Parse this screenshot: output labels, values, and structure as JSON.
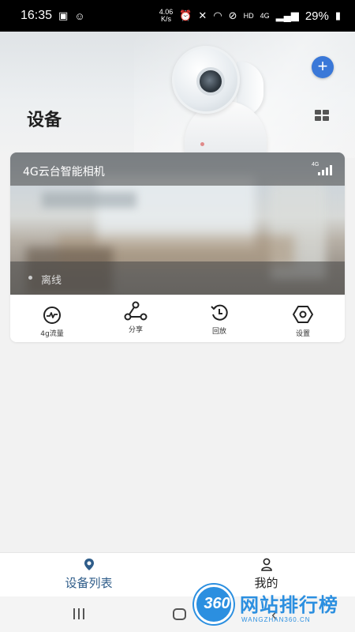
{
  "status_bar": {
    "time": "16:35",
    "speed_value": "4.06",
    "speed_unit": "K/s",
    "network": "4G",
    "hd": "HD",
    "battery": "29%"
  },
  "header": {
    "title": "设备",
    "add_icon": "plus-icon",
    "layout_icon": "grid-icon"
  },
  "device_card": {
    "name": "4G云台智能相机",
    "signal_label": "4G",
    "signal_level": 0.75,
    "status": "离线",
    "actions": [
      {
        "label": "4g流量",
        "icon": "data-usage-icon"
      },
      {
        "label": "分享",
        "icon": "share-icon"
      },
      {
        "label": "回放",
        "icon": "playback-icon"
      },
      {
        "label": "设置",
        "icon": "settings-icon"
      }
    ]
  },
  "bottom_nav": {
    "items": [
      {
        "label": "设备列表",
        "icon": "location-pin-icon",
        "active": true
      },
      {
        "label": "我的",
        "icon": "user-icon",
        "active": false
      }
    ]
  },
  "watermark": {
    "number": "360",
    "text": "网站排行榜",
    "url": "WANGZHAN360.CN"
  },
  "colors": {
    "accent": "#3a78d8",
    "nav_active": "#2f5d8a",
    "watermark": "#2b8fe0"
  }
}
